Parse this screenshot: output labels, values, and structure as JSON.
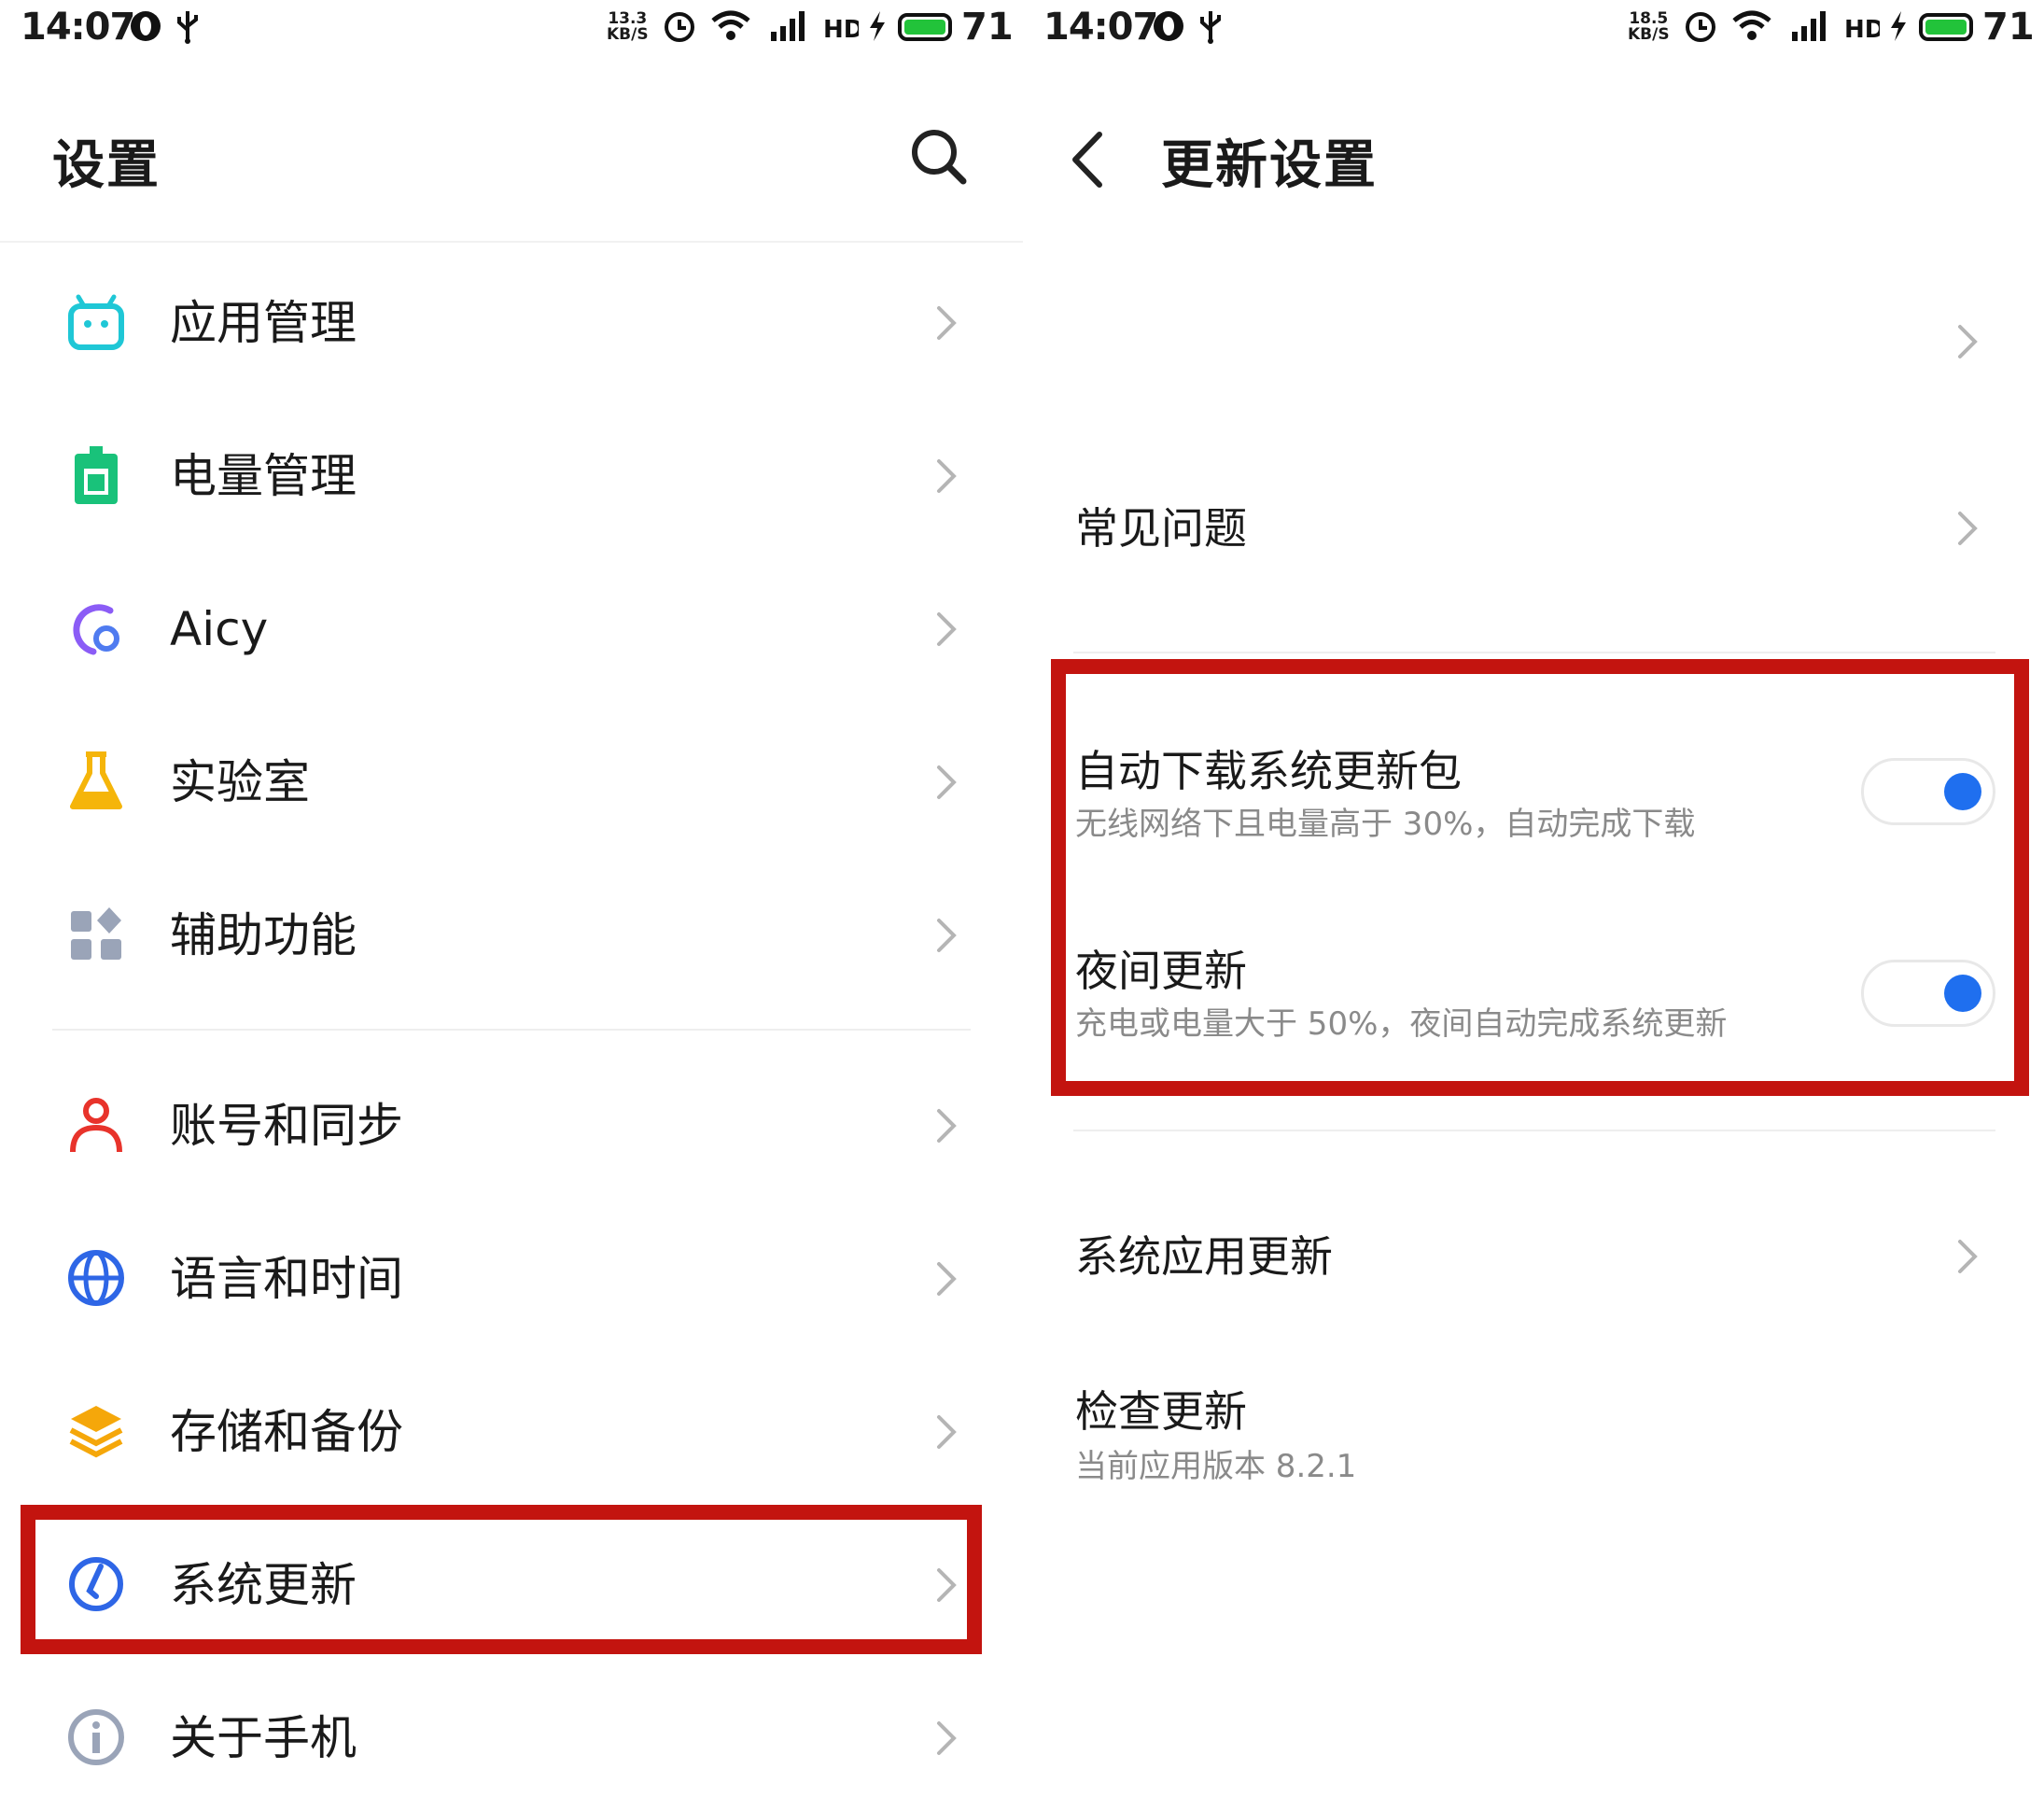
{
  "colors": {
    "highlight": "#c3140f",
    "toggle_on": "#1f6fef",
    "battery": "#22c33a",
    "subtext": "#8a8a8a"
  },
  "status_left": {
    "time": "14:07",
    "speed_top": "13.3",
    "speed_unit": "KB/S",
    "battery": "71"
  },
  "status_right": {
    "time": "14:07",
    "speed_top": "18.5",
    "speed_unit": "KB/S",
    "battery": "71"
  },
  "status_icons": [
    "opera-icon",
    "usb-icon",
    "alarm-icon",
    "wifi-icon",
    "signal-4g-icon",
    "hd-icon",
    "charging-icon",
    "battery-icon"
  ],
  "settings": {
    "title": "设置",
    "items": [
      {
        "label": "应用管理",
        "icon": "android-icon",
        "color": "#1fc7d6"
      },
      {
        "label": "电量管理",
        "icon": "battery-manage-icon",
        "color": "#19c27a"
      },
      {
        "label": "Aicy",
        "icon": "aicy-icon",
        "color": "#8b5cf6"
      },
      {
        "label": "实验室",
        "icon": "flask-icon",
        "color": "#f5b50a"
      },
      {
        "label": "辅助功能",
        "icon": "accessibility-icon",
        "color": "#9aa4b8"
      },
      {
        "label": "账号和同步",
        "icon": "account-icon",
        "color": "#e8332b"
      },
      {
        "label": "语言和时间",
        "icon": "globe-icon",
        "color": "#2e66e6"
      },
      {
        "label": "存储和备份",
        "icon": "layers-icon",
        "color": "#f5a70a"
      },
      {
        "label": "系统更新",
        "icon": "system-update-icon",
        "color": "#2e66e6"
      },
      {
        "label": "关于手机",
        "icon": "info-icon",
        "color": "#9aa4b8"
      }
    ]
  },
  "update_settings": {
    "title": "更新设置",
    "faq": "常见问题",
    "auto_download": {
      "label": "自动下载系统更新包",
      "sub": "无线网络下且电量高于 30%，自动完成下载",
      "on": true
    },
    "night_update": {
      "label": "夜间更新",
      "sub": "充电或电量大于 50%，夜间自动完成系统更新",
      "on": true
    },
    "app_update": "系统应用更新",
    "check_update": {
      "label": "检查更新",
      "sub": "当前应用版本 8.2.1"
    }
  }
}
